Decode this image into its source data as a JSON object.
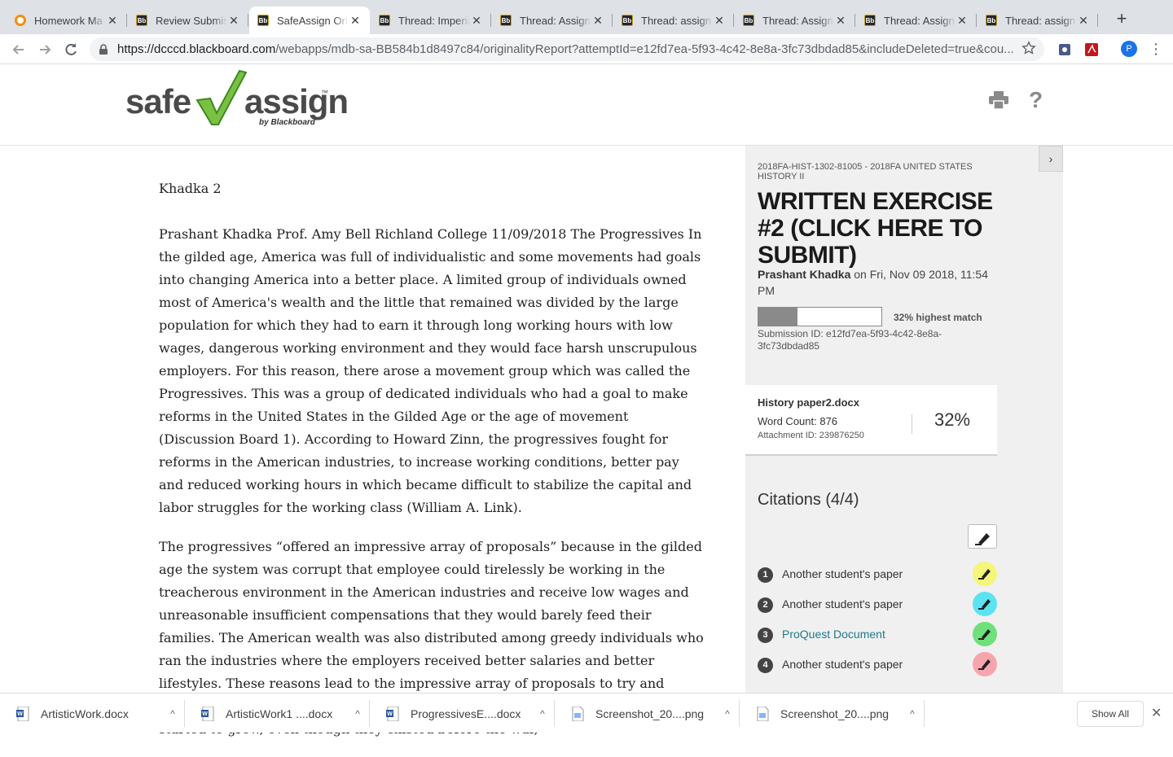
{
  "browser": {
    "tabs": [
      {
        "title": "Homework Ma",
        "icon": "hw"
      },
      {
        "title": "Review Submis",
        "icon": "bb"
      },
      {
        "title": "SafeAssign Ori",
        "icon": "bb",
        "active": true
      },
      {
        "title": "Thread: Imperia",
        "icon": "bb"
      },
      {
        "title": "Thread: Assign",
        "icon": "bb"
      },
      {
        "title": "Thread: assign",
        "icon": "bb"
      },
      {
        "title": "Thread: Assign",
        "icon": "bb"
      },
      {
        "title": "Thread: Assign",
        "icon": "bb"
      },
      {
        "title": "Thread: assign",
        "icon": "bb"
      }
    ],
    "favicon_text": "Bb",
    "close_glyph": "✕",
    "new_tab_glyph": "+",
    "url_host": "https://dcccd.blackboard.com",
    "url_rest": "/webapps/mdb-sa-BB584b1d8497c84/originalityReport?attemptId=e12fd7ea-5f93-4c42-8e8a-3fc73dbdad85&includeDeleted=true&cou...",
    "profile_initial": "P"
  },
  "logo": {
    "part1": "safe",
    "part2": "assign",
    "tm": "™",
    "sub": "by Blackboard"
  },
  "header": {
    "help_label": "?"
  },
  "document": {
    "header_line": "Khadka 2",
    "paragraphs": [
      "Prashant Khadka Prof. Amy Bell Richland College 11/09/2018 The Progressives In the gilded age, America was full of individualistic and some movements had goals into changing America into a better place. A limited group of individuals owned most of America's wealth and the little that remained was divided by the large population for which they had to earn it through long working hours with low wages, dangerous working environment and they would face harsh unscrupulous employers. For this reason, there arose a movement group which was called the Progressives. This was a group of dedicated individuals who had a goal to make reforms in the United States in the Gilded Age or the age of movement (Discussion Board 1). According to Howard Zinn, the progressives fought for reforms in the American industries, to increase working conditions, better pay and reduced working hours in which became difficult to stabilize the capital and labor struggles for the working class (William A. Link).",
      "The progressives “offered an impressive array of proposals” because in the gilded age the system was corrupt that employee could tirelessly be working in the treacherous environment in the American industries and receive low wages and unreasonable insufficient compensations that they would barely feed their families. The American wealth was also distributed among greedy individuals who ran the industries where the employers received better salaries and better lifestyles. These reasons lead to the impressive array of proposals to try and change the American social structure. After the war, industries and business started to grow, even though they existed before the war,"
    ]
  },
  "panel": {
    "collapse_glyph": "›",
    "course": "2018FA-HIST-1302-81005 - 2018FA UNITED STATES HISTORY II",
    "assignment_title": "WRITTEN EXERCISE #2 (CLICK HERE TO SUBMIT)",
    "submitter_name": "Prashant Khadka",
    "submitted_text": " on Fri, Nov 09 2018, 11:54 PM",
    "match_fraction": 0.32,
    "match_label": "32% highest match",
    "submission_id": "Submission ID: e12fd7ea-5f93-4c42-8e8a-3fc73dbdad85",
    "file": {
      "name": "History paper2.docx",
      "word_count": "Word Count: 876",
      "attachment_id": "Attachment ID: 239876250",
      "percent": "32%"
    },
    "citations_title": "Citations (4/4)",
    "citations": [
      {
        "num": "1",
        "label": "Another student's paper",
        "color": "#f5f57a",
        "link": false
      },
      {
        "num": "2",
        "label": "Another student's paper",
        "color": "#5ce3f2",
        "link": false
      },
      {
        "num": "3",
        "label": "ProQuest Document",
        "color": "#6fe07a",
        "link": true
      },
      {
        "num": "4",
        "label": "Another student's paper",
        "color": "#f7a5ad",
        "link": false
      }
    ]
  },
  "downloads": {
    "items": [
      {
        "name": "ArtisticWork.docx",
        "type": "word"
      },
      {
        "name": "ArtisticWork1 ....docx",
        "type": "word"
      },
      {
        "name": "ProgressivesE....docx",
        "type": "word"
      },
      {
        "name": "Screenshot_20....png",
        "type": "image"
      },
      {
        "name": "Screenshot_20....png",
        "type": "image"
      }
    ],
    "show_all": "Show All",
    "close_glyph": "✕",
    "chevron_glyph": "^"
  }
}
